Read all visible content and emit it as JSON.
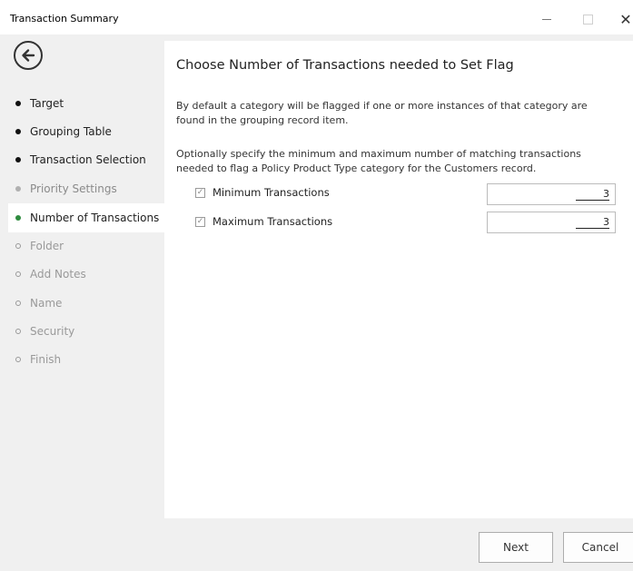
{
  "window": {
    "title": "Transaction Summary",
    "controls": {
      "minimize": "–",
      "maximize": "□",
      "close": "✕"
    }
  },
  "sidebar": {
    "back_icon": "arrow-left-circle-icon",
    "steps": [
      {
        "label": "Target",
        "state": "done"
      },
      {
        "label": "Grouping Table",
        "state": "done"
      },
      {
        "label": "Transaction Selection",
        "state": "done"
      },
      {
        "label": "Priority Settings",
        "state": "disabled"
      },
      {
        "label": "Number of Transactions",
        "state": "current"
      },
      {
        "label": "Folder",
        "state": "todo"
      },
      {
        "label": "Add Notes",
        "state": "todo"
      },
      {
        "label": "Name",
        "state": "todo"
      },
      {
        "label": "Security",
        "state": "todo"
      },
      {
        "label": "Finish",
        "state": "todo"
      }
    ]
  },
  "main": {
    "heading": "Choose Number of Transactions needed to Set Flag",
    "para1": "By default a category will be flagged if one or more instances of that category are found in the grouping record item.",
    "para2": "Optionally specify the minimum and maximum number of matching transactions needed to flag a Policy Product Type category for the Customers record.",
    "options": [
      {
        "label": "Minimum Transactions",
        "checked": true,
        "value": "3"
      },
      {
        "label": "Maximum Transactions",
        "checked": true,
        "value": "3"
      }
    ]
  },
  "footer": {
    "next": "Next",
    "cancel": "Cancel"
  },
  "colors": {
    "current_dot": "#2e8b3e",
    "sidebar_bg": "#f0f0f0",
    "content_bg": "#ffffff"
  }
}
